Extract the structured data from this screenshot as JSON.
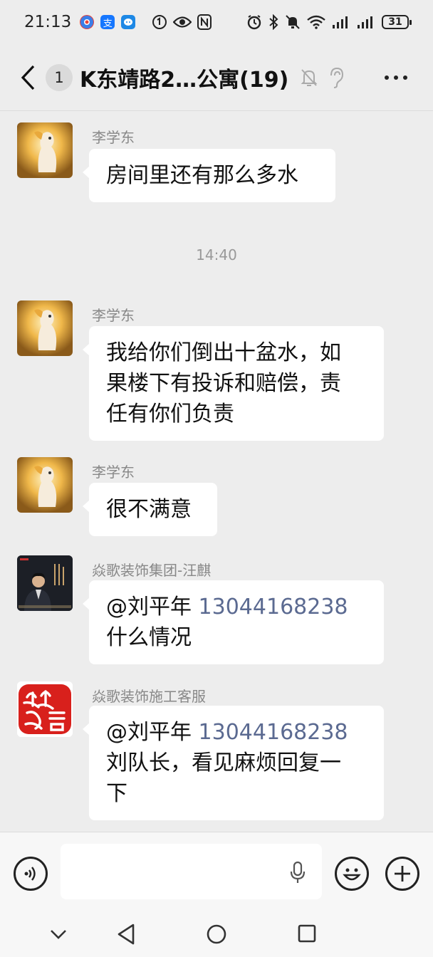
{
  "status_bar": {
    "time": "21:13",
    "battery": "31",
    "app_icons": [
      "chrome-like-icon",
      "alipay-icon",
      "messenger-icon"
    ],
    "system_icons": [
      "vpn-icon",
      "eye-icon",
      "nfc-icon",
      "alarm-icon",
      "bluetooth-icon",
      "mute-icon",
      "wifi-icon",
      "signal-icon",
      "signal-icon"
    ]
  },
  "header": {
    "unread_count": "1",
    "title": "K东靖路2…公寓(19)"
  },
  "timestamp": "14:40",
  "messages": [
    {
      "sender": "李学东",
      "avatar": "golden-horse",
      "text": "房间里还有那么多水"
    },
    {
      "sender": "李学东",
      "avatar": "golden-horse",
      "lines": [
        "我给你们倒出十盆水，如",
        "果楼下有投诉和赔偿，责",
        "任有你们负责"
      ]
    },
    {
      "sender": "李学东",
      "avatar": "golden-horse",
      "text": "很不满意"
    },
    {
      "sender": "焱歌装饰集团-汪麒",
      "avatar": "person-photo",
      "mention": "@刘平年",
      "phone": "13044168238",
      "line2": "什么情况"
    },
    {
      "sender": "焱歌装饰施工客服",
      "avatar": "red-seal-logo",
      "mention": "@刘平年",
      "phone": "13044168238",
      "line2": "刘队长，看见麻烦回复一",
      "line3": "下"
    }
  ],
  "colors": {
    "background": "#ededed",
    "bubble": "#ffffff",
    "phone_link": "#5b6a91",
    "sender_name": "#888888"
  }
}
